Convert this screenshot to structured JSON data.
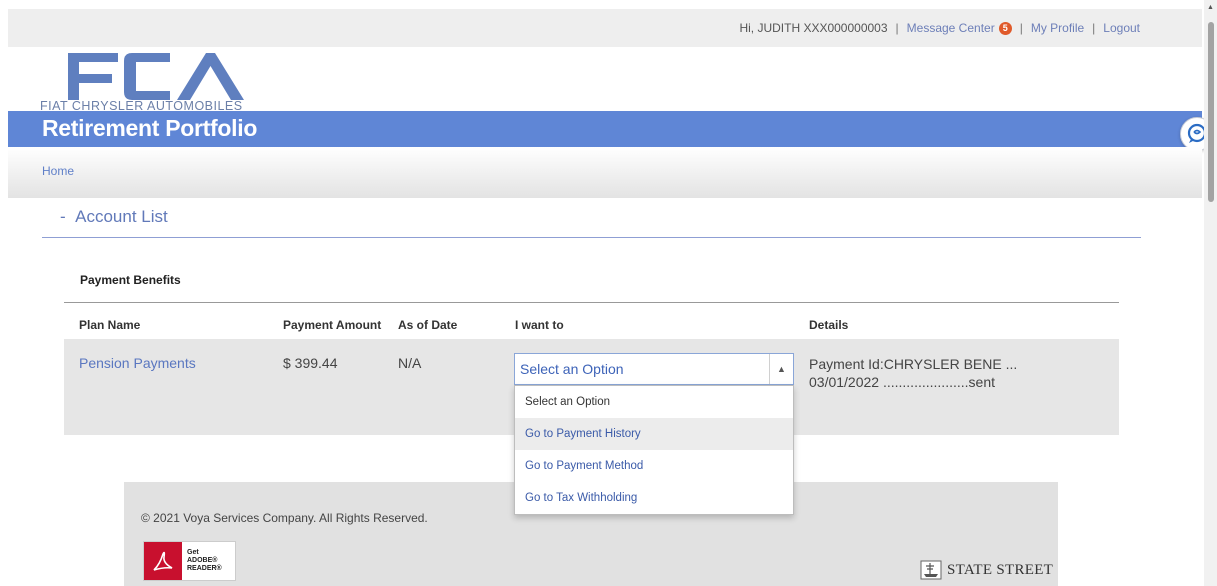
{
  "header": {
    "greeting": "Hi, JUDITH XXX000000003",
    "message_center": "Message Center",
    "message_count": "5",
    "my_profile": "My Profile",
    "logout": "Logout",
    "separator": "|"
  },
  "brand": {
    "logo_text": "FCA",
    "logo_subtext": "FIAT CHRYSLER AUTOMOBILES",
    "portal_title": "Retirement Portfolio",
    "accent_color": "#5f86d6"
  },
  "breadcrumb": {
    "home": "Home"
  },
  "account_list": {
    "collapse_symbol": "-",
    "title": "Account List"
  },
  "payment_benefits": {
    "section_title": "Payment Benefits",
    "columns": [
      "Plan Name",
      "Payment Amount",
      "As of Date",
      "I want to",
      "Details"
    ],
    "row": {
      "plan_name": "Pension Payments",
      "payment_amount": "$ 399.44",
      "as_of_date": "N/A",
      "details_line1": "Payment Id:CHRYSLER BENE ...",
      "details_line2": "03/01/2022 ......................sent"
    }
  },
  "action_select": {
    "selected": "Select an Option",
    "options": [
      "Select an Option",
      "Go to Payment History",
      "Go to Payment Method",
      "Go to Tax Withholding"
    ],
    "highlighted_index": 1
  },
  "footer": {
    "copyright": "© 2021 Voya Services Company. All Rights Reserved.",
    "adobe_line1": "Get",
    "adobe_line2": "ADOBE®",
    "adobe_line3": "READER®",
    "partner": "STATE STREET"
  },
  "icons": {
    "chat": "chat-bubble-icon",
    "dropdown_arrow": "caret-up-icon",
    "adobe": "adobe-reader-icon",
    "state_street": "ship-icon"
  }
}
